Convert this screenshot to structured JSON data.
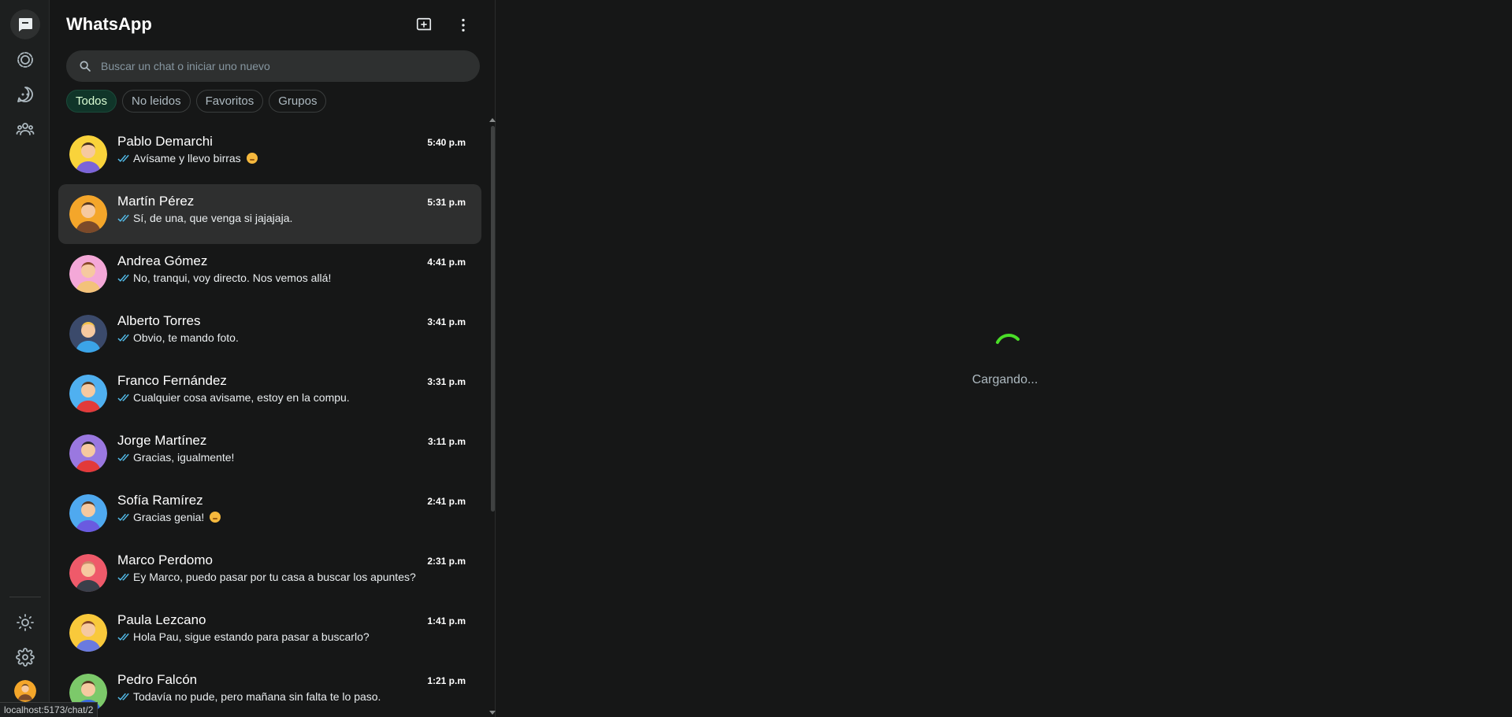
{
  "app": {
    "title": "WhatsApp"
  },
  "colors": {
    "accent": "#25d366",
    "tick": "#53bdeb",
    "spinner": "#4ade28"
  },
  "rail": {
    "items": [
      {
        "name": "chats",
        "icon": "chats-icon",
        "active": true
      },
      {
        "name": "status",
        "icon": "status-icon",
        "active": false
      },
      {
        "name": "channels",
        "icon": "channels-icon",
        "active": false
      },
      {
        "name": "communities",
        "icon": "communities-icon",
        "active": false
      }
    ],
    "bottom": [
      {
        "name": "theme",
        "icon": "sun-icon"
      },
      {
        "name": "settings",
        "icon": "gear-icon"
      }
    ]
  },
  "header": {
    "new_chat_icon": "new-chat-icon",
    "menu_icon": "more-vertical-icon"
  },
  "search": {
    "placeholder": "Buscar un chat o iniciar uno nuevo"
  },
  "filters": [
    {
      "label": "Todos",
      "active": true
    },
    {
      "label": "No leidos",
      "active": false
    },
    {
      "label": "Favoritos",
      "active": false
    },
    {
      "label": "Grupos",
      "active": false
    }
  ],
  "chats": [
    {
      "name": "Pablo Demarchi",
      "time": "5:40 p.m",
      "preview": "Avísame y llevo birras",
      "emoji": true,
      "selected": false
    },
    {
      "name": "Martín Pérez",
      "time": "5:31 p.m",
      "preview": "Sí, de una, que venga si jajajaja.",
      "emoji": false,
      "selected": true
    },
    {
      "name": "Andrea Gómez",
      "time": "4:41 p.m",
      "preview": "No, tranqui, voy directo. Nos vemos allá!",
      "emoji": false,
      "selected": false
    },
    {
      "name": "Alberto Torres",
      "time": "3:41 p.m",
      "preview": "Obvio, te mando foto.",
      "emoji": false,
      "selected": false
    },
    {
      "name": "Franco Fernández",
      "time": "3:31 p.m",
      "preview": "Cualquier cosa avisame, estoy en la compu.",
      "emoji": false,
      "selected": false
    },
    {
      "name": "Jorge Martínez",
      "time": "3:11 p.m",
      "preview": "Gracias, igualmente!",
      "emoji": false,
      "selected": false
    },
    {
      "name": "Sofía Ramírez",
      "time": "2:41 p.m",
      "preview": "Gracias genia!",
      "emoji": true,
      "selected": false
    },
    {
      "name": "Marco Perdomo",
      "time": "2:31 p.m",
      "preview": "Ey Marco, puedo pasar por tu casa a buscar los apuntes?",
      "emoji": false,
      "selected": false
    },
    {
      "name": "Paula Lezcano",
      "time": "1:41 p.m",
      "preview": "Hola Pau, sigue estando para pasar a buscarlo?",
      "emoji": false,
      "selected": false
    },
    {
      "name": "Pedro Falcón",
      "time": "1:21 p.m",
      "preview": "Todavía no pude, pero mañana sin falta te lo paso.",
      "emoji": false,
      "selected": false
    }
  ],
  "main": {
    "loading_text": "Cargando..."
  },
  "statusbar": {
    "url": "localhost:5173/chat/2"
  }
}
